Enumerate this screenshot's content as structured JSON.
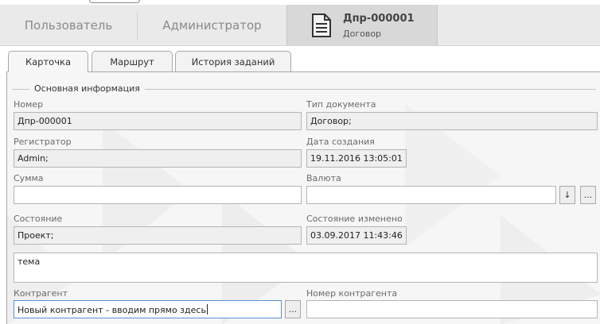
{
  "header": {
    "user_label": "Пользователь",
    "admin_label": "Администратор",
    "doc_number": "Дпр-000001",
    "doc_type": "Договор"
  },
  "tabs": [
    {
      "label": "Карточка"
    },
    {
      "label": "Маршрут"
    },
    {
      "label": "История заданий"
    }
  ],
  "form": {
    "group_title": "Основная информация",
    "number_label": "Номер",
    "number_value": "Дпр-000001",
    "doctype_label": "Тип документа",
    "doctype_value": "Договор;",
    "registrar_label": "Регистратор",
    "registrar_value": "Admin;",
    "created_label": "Дата создания",
    "created_value": "19.11.2016  13:05:01",
    "sum_label": "Сумма",
    "sum_value": "",
    "currency_label": "Валюта",
    "currency_value": "",
    "state_label": "Состояние",
    "state_value": "Проект;",
    "state_changed_label": "Состояние изменено",
    "state_changed_value": "03.09.2017  11:43:46",
    "subject_value": "тема",
    "contractor_label": "Контрагент",
    "contractor_value": "Новый контрагент - вводим прямо здесь",
    "contractor_number_label": "Номер контрагента",
    "contractor_number_value": "",
    "ellipsis": "...",
    "arrow": "↓"
  }
}
